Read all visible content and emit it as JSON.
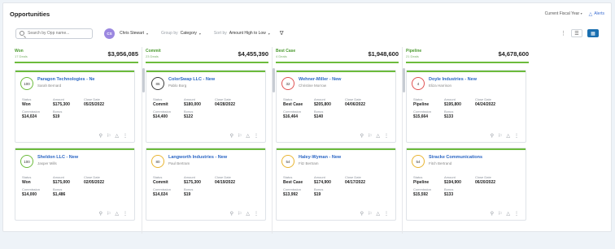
{
  "header": {
    "title": "Opportunities",
    "period": "Current Fiscal Year",
    "alerts": "Alerts"
  },
  "toolbar": {
    "search_placeholder": "Search by Opp name...",
    "avatar_initials": "CS",
    "user_name": "Chris Stewart",
    "group_by_label": "Group by",
    "group_by_value": "Category",
    "sort_label": "Sort by",
    "sort_value": "Amount High to Low"
  },
  "columns": [
    {
      "name": "Won",
      "count": "17 Deals",
      "total": "$3,956,085",
      "cards": [
        {
          "score": "100",
          "ring_color": "#6cbb3c",
          "top_color": "#6cbb3c",
          "title": "Paragon Technologies - Ne",
          "owner": "Sarah Bernard",
          "status_label": "Status",
          "status": "Won",
          "amount_label": "Amount",
          "amount": "$175,300",
          "close_label": "Close Date",
          "close": "05/25/2022",
          "commission_label": "Commission",
          "commission": "$14,024",
          "bonus_label": "Bonus",
          "bonus": "$19"
        },
        {
          "score": "100",
          "ring_color": "#6cbb3c",
          "top_color": "#6cbb3c",
          "title": "Sheldon LLC - New",
          "owner": "Jasper Mills",
          "status_label": "Status",
          "status": "Won",
          "amount_label": "Amount",
          "amount": "$175,000",
          "close_label": "Close Date",
          "close": "02/05/2022",
          "commission_label": "Commission",
          "commission": "$14,000",
          "bonus_label": "Bonus",
          "bonus": "$1,486"
        }
      ]
    },
    {
      "name": "Commit",
      "count": "23 Deals",
      "total": "$4,455,390",
      "cards": [
        {
          "score": "86",
          "ring_color": "#3a3a3a",
          "top_color": "#6cbb3c",
          "title": "ColorSwap LLC - New",
          "owner": "Pablo Borg",
          "status_label": "Status",
          "status": "Commit",
          "amount_label": "Amount",
          "amount": "$180,000",
          "close_label": "Close Date",
          "close": "04/28/2022",
          "commission_label": "Commission",
          "commission": "$14,400",
          "bonus_label": "Bonus",
          "bonus": "$122"
        },
        {
          "score": "80",
          "ring_color": "#e9b531",
          "top_color": "#6cbb3c",
          "title": "Langworth Industries - New",
          "owner": "Paul Bertram",
          "status_label": "Status",
          "status": "Commit",
          "amount_label": "Amount",
          "amount": "$175,300",
          "close_label": "Close Date",
          "close": "04/19/2022",
          "commission_label": "Commission",
          "commission": "$14,024",
          "bonus_label": "Bonus",
          "bonus": "$19"
        }
      ]
    },
    {
      "name": "Best Case",
      "count": "4 Deals",
      "total": "$1,948,600",
      "cards": [
        {
          "score": "32",
          "ring_color": "#e05252",
          "top_color": "#6cbb3c",
          "title": "Wehner-Miller - New",
          "owner": "Christine Morrow",
          "status_label": "Status",
          "status": "Best Case",
          "amount_label": "Amount",
          "amount": "$205,800",
          "close_label": "Close Date",
          "close": "04/06/2022",
          "commission_label": "Commission",
          "commission": "$16,464",
          "bonus_label": "Bonus",
          "bonus": "$140"
        },
        {
          "score": "54",
          "ring_color": "#e9b531",
          "top_color": "#6cbb3c",
          "title": "Haley-Wyman - New",
          "owner": "Fitz Bertram",
          "status_label": "Status",
          "status": "Best Case",
          "amount_label": "Amount",
          "amount": "$174,900",
          "close_label": "Close Date",
          "close": "04/17/2022",
          "commission_label": "Commission",
          "commission": "$13,992",
          "bonus_label": "Bonus",
          "bonus": "$19"
        }
      ]
    },
    {
      "name": "Pipeline",
      "count": "21 Deals",
      "total": "$4,678,600",
      "cards": [
        {
          "score": "4",
          "ring_color": "#e05252",
          "top_color": "#6cbb3c",
          "title": "Doyle Industries - New",
          "owner": "Eliza Harrison",
          "status_label": "Status",
          "status": "Pipeline",
          "amount_label": "Amount",
          "amount": "$195,800",
          "close_label": "Close Date",
          "close": "04/24/2022",
          "commission_label": "Commission",
          "commission": "$15,664",
          "bonus_label": "Bonus",
          "bonus": "$133"
        },
        {
          "score": "54",
          "ring_color": "#e9b531",
          "top_color": "#6cbb3c",
          "title": "Stracke Communications",
          "owner": "Fitch Bertrand",
          "status_label": "Status",
          "status": "Pipeline",
          "amount_label": "Amount",
          "amount": "$194,900",
          "close_label": "Close Date",
          "close": "06/20/2022",
          "commission_label": "Commission",
          "commission": "$15,592",
          "bonus_label": "Bonus",
          "bonus": "$133"
        }
      ]
    }
  ]
}
